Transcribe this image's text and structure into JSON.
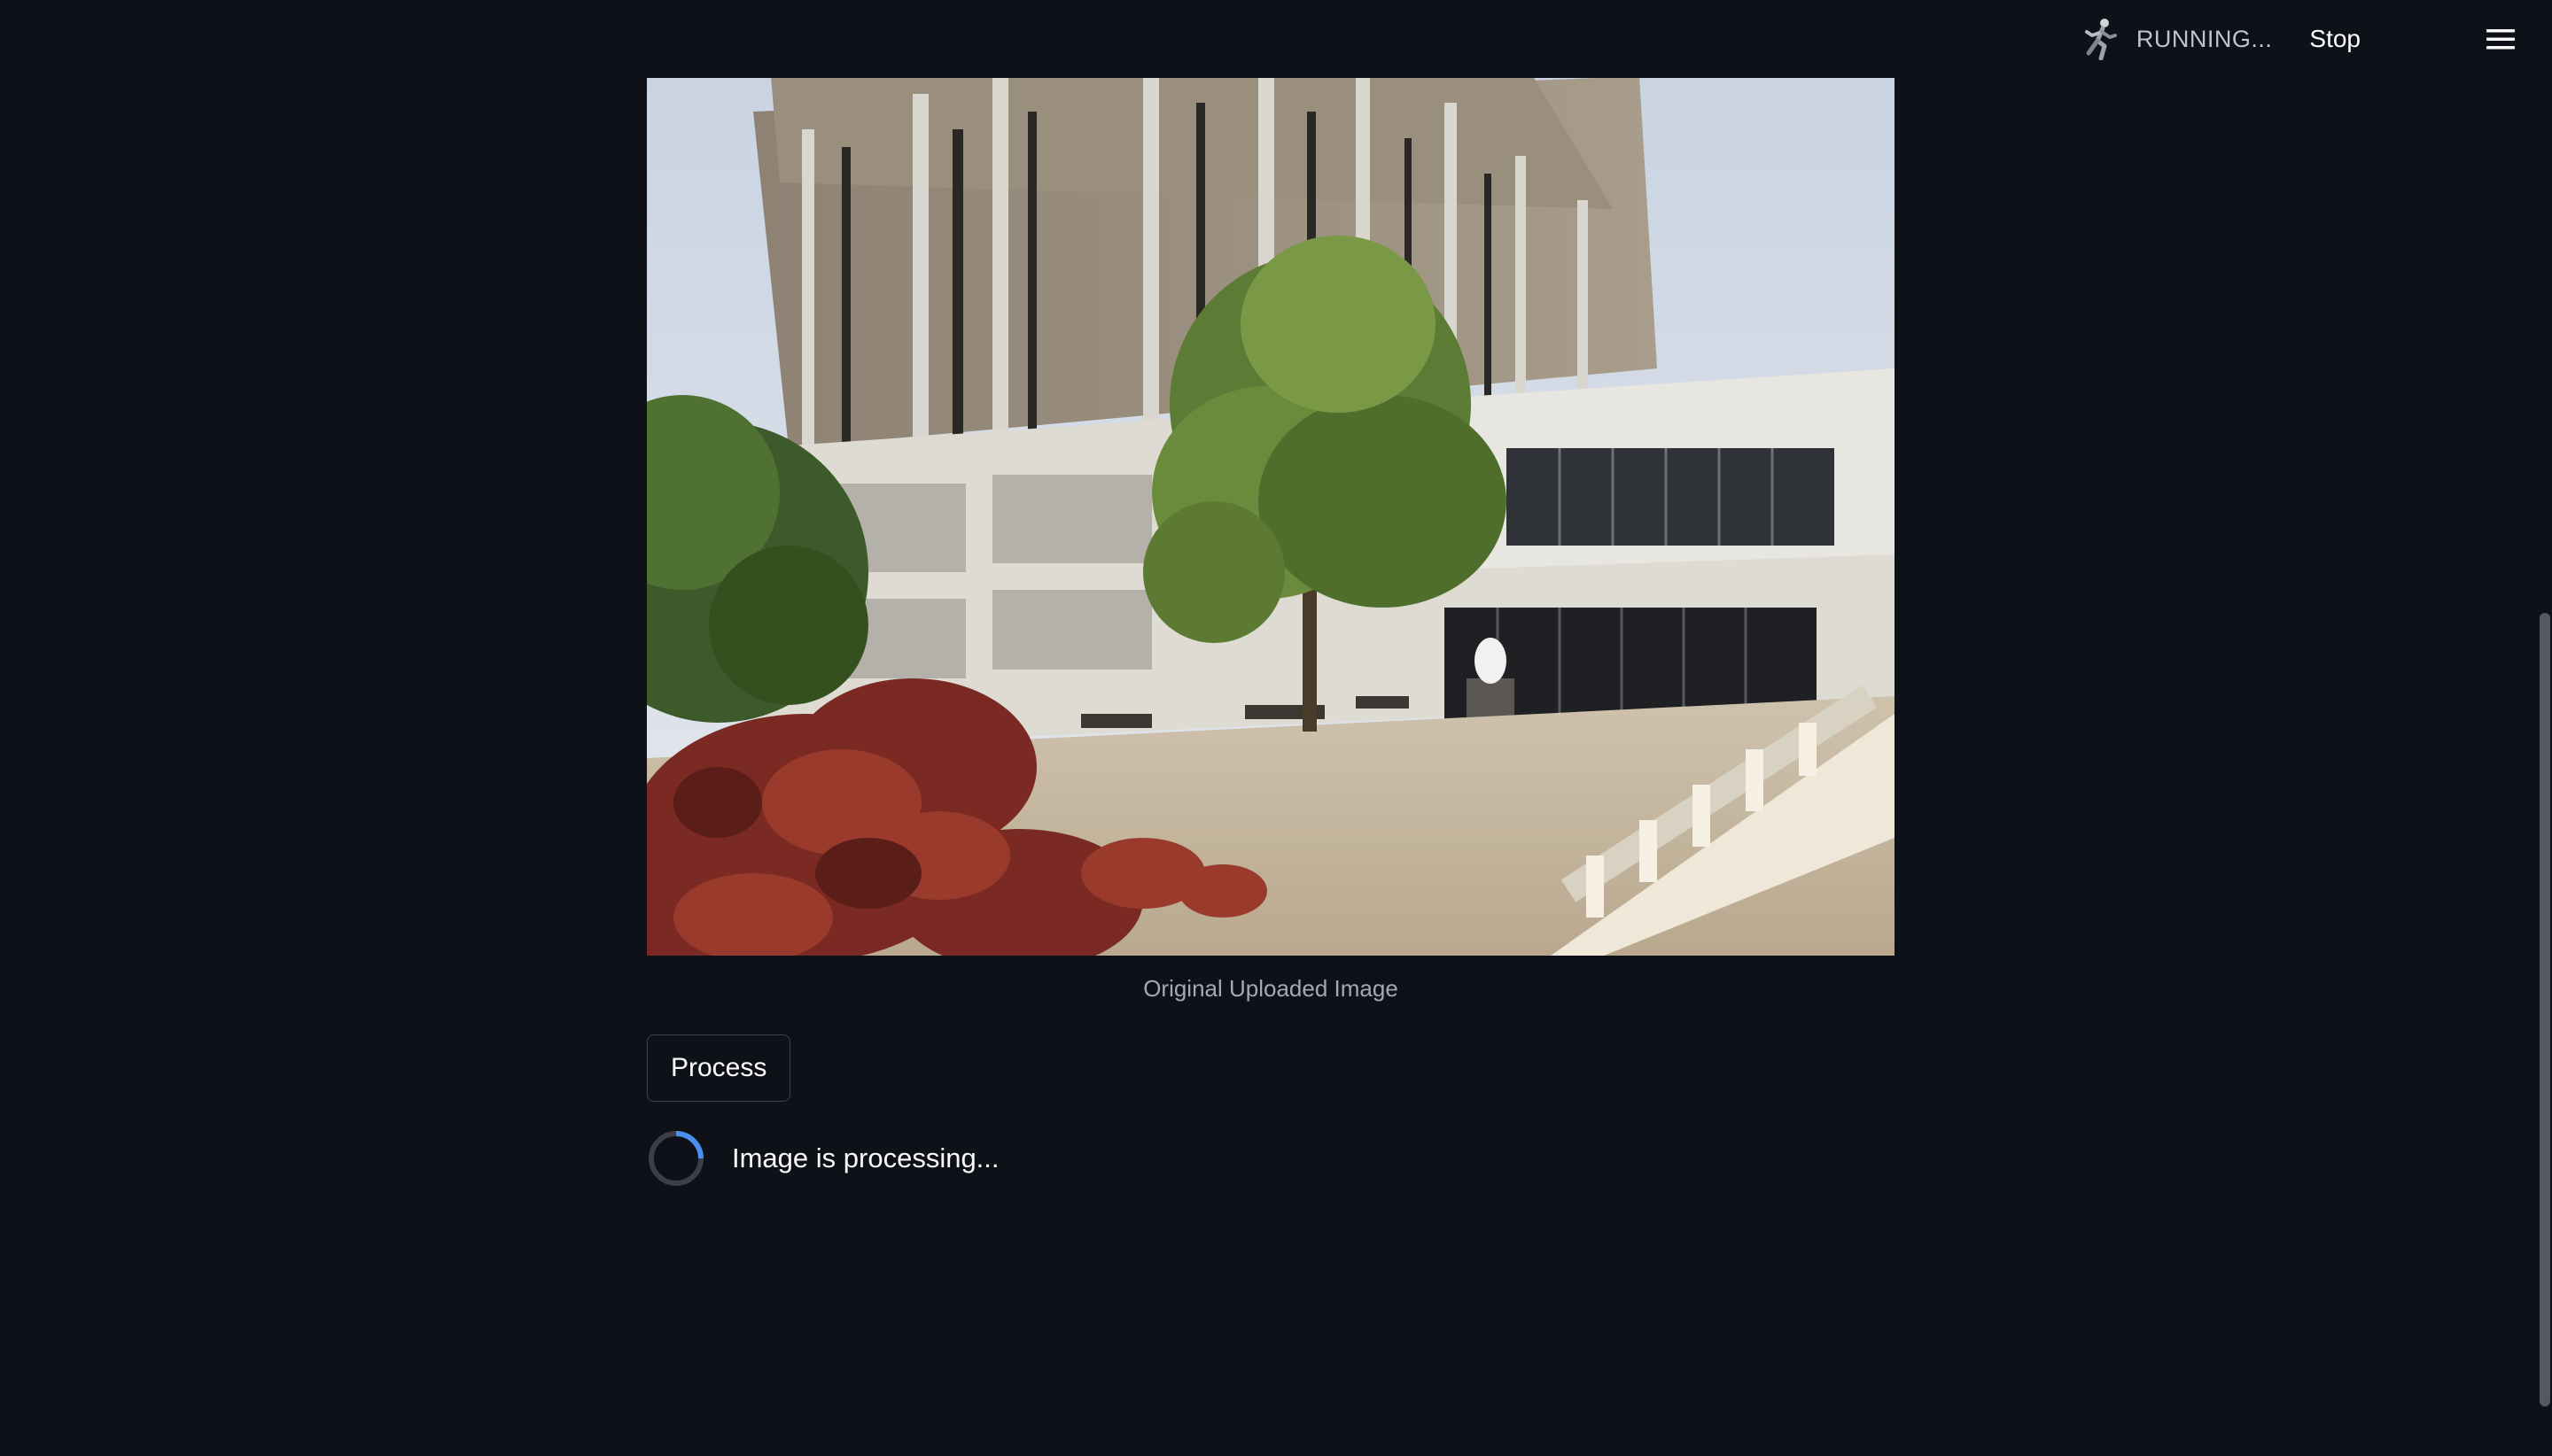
{
  "header": {
    "status_text": "RUNNING...",
    "stop_label": "Stop",
    "running_icon": "running-man-icon",
    "menu_icon": "hamburger-menu-icon"
  },
  "main": {
    "image_caption": "Original Uploaded Image",
    "process_label": "Process",
    "spinner_text": "Image is processing..."
  },
  "colors": {
    "background": "#0e1117",
    "text": "#fafafa",
    "caption": "#a3a8b4",
    "spinner_accent": "#4a8ff0",
    "button_border": "#3d414b"
  }
}
